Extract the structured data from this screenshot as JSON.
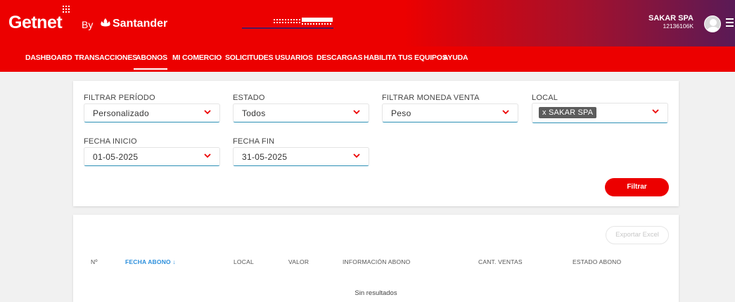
{
  "header": {
    "logo_text": "Getnet",
    "by_text": "By",
    "brand_text": "Santander",
    "user_name": "SAKAR SPA",
    "user_rut": "12136106K"
  },
  "nav": {
    "items": [
      "DASHBOARD",
      "TRANSACCIONES",
      "ABONOS",
      "MI COMERCIO",
      "SOLICITUDES",
      "USUARIOS",
      "DESCARGAS",
      "HABILITA TUS EQUIPOS",
      "AYUDA"
    ],
    "active": "ABONOS"
  },
  "filters": {
    "periodo": {
      "label": "FILTRAR PERÍODO",
      "value": "Personalizado"
    },
    "estado": {
      "label": "ESTADO",
      "value": "Todos"
    },
    "moneda": {
      "label": "FILTRAR MONEDA VENTA",
      "value": "Peso"
    },
    "local": {
      "label": "LOCAL",
      "chip": "x SAKAR SPA"
    },
    "fecha_inicio": {
      "label": "FECHA INICIO",
      "value": "01-05-2025"
    },
    "fecha_fin": {
      "label": "FECHA FIN",
      "value": "31-05-2025"
    },
    "submit_label": "Filtrar"
  },
  "results": {
    "export_label": "Exportar Excel",
    "columns": [
      "Nº",
      "FECHA ABONO ↓",
      "LOCAL",
      "VALOR",
      "INFORMACIÓN ABONO",
      "CANT. VENTAS",
      "ESTADO ABONO"
    ],
    "empty_text": "Sin resultados"
  },
  "colors": {
    "brand_red": "#ec0000",
    "accent_blue": "#2c8fdc",
    "header_gradient_end": "#5a1a56"
  }
}
